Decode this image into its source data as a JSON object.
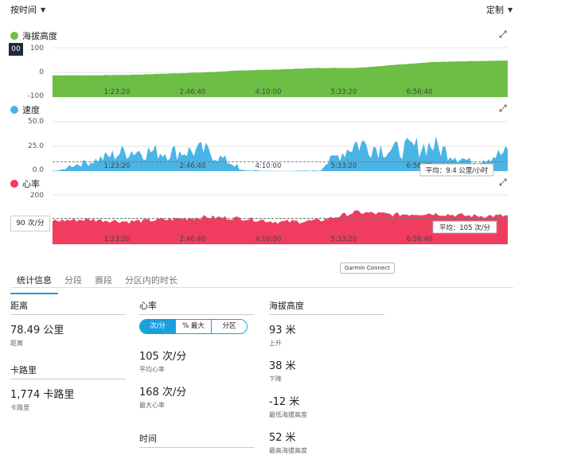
{
  "toolbar": {
    "sort_label": "按时间",
    "custom_label": "定制"
  },
  "colors": {
    "elevation": "#6cbe45",
    "speed": "#4ab4e6",
    "heart_rate": "#f03c5f",
    "accent": "#1aa0dd"
  },
  "charts": {
    "elevation": {
      "title": "海拔高度",
      "y_ticks": [
        "100",
        "0",
        "-100"
      ],
      "left_badge": "00"
    },
    "speed": {
      "title": "速度",
      "y_ticks": [
        "50.0",
        "25.0",
        "0.0"
      ],
      "avg_label": "平均：9.4 公里/小时"
    },
    "heart_rate": {
      "title": "心率",
      "y_ticks": [
        "200",
        "100"
      ],
      "left_badge": "90 次/分",
      "avg_label": "平均：105 次/分"
    },
    "x_ticks": [
      "1:23:20",
      "2:46:40",
      "4:10:00",
      "5:33:20",
      "6:56:40"
    ]
  },
  "chart_data": [
    {
      "type": "area",
      "title": "海拔高度",
      "ylim": [
        -100,
        100
      ],
      "x": [
        "0:00:00",
        "0:41:40",
        "1:23:20",
        "2:05:00",
        "2:46:40",
        "3:28:20",
        "4:10:00",
        "4:51:40",
        "5:33:20",
        "6:15:00",
        "6:56:40",
        "7:38:20",
        "8:20:00"
      ],
      "series": [
        {
          "name": "海拔高度",
          "values": [
            -12,
            -12,
            -10,
            -5,
            0,
            8,
            12,
            18,
            18,
            30,
            42,
            45,
            48
          ]
        }
      ]
    },
    {
      "type": "area",
      "title": "速度",
      "ylim": [
        0,
        50
      ],
      "avg": 9.4,
      "x": [
        "0:00:00",
        "0:41:40",
        "1:23:20",
        "2:05:00",
        "2:46:40",
        "3:28:20",
        "4:10:00",
        "4:51:40",
        "5:33:20",
        "6:15:00",
        "6:56:40",
        "7:38:20",
        "8:20:00"
      ],
      "series": [
        {
          "name": "速度",
          "values": [
            2,
            10,
            22,
            20,
            22,
            3,
            0,
            2,
            30,
            22,
            28,
            10,
            20
          ]
        }
      ]
    },
    {
      "type": "area",
      "title": "心率",
      "ylim": [
        0,
        200
      ],
      "avg": 105,
      "x": [
        "0:00:00",
        "0:41:40",
        "1:23:20",
        "2:05:00",
        "2:46:40",
        "3:28:20",
        "4:10:00",
        "4:51:40",
        "5:33:20",
        "6:15:00",
        "6:56:40",
        "7:38:20",
        "8:20:00"
      ],
      "series": [
        {
          "name": "心率",
          "values": [
            95,
            100,
            92,
            100,
            110,
            105,
            90,
            95,
            130,
            120,
            125,
            115,
            115
          ]
        }
      ]
    }
  ],
  "garmin_label": "Garmin Connect",
  "tabs": [
    "统计信息",
    "分段",
    "赛段",
    "分区内的时长"
  ],
  "stats": {
    "distance": {
      "heading": "距离",
      "value": "78.49 公里",
      "label": "距离"
    },
    "calories": {
      "heading": "卡路里",
      "value": "1,774 卡路里",
      "label": "卡路里"
    },
    "heart_rate": {
      "heading": "心率",
      "toggle": [
        "次/分",
        "% 最大",
        "分区"
      ],
      "avg_value": "105 次/分",
      "avg_label": "平均心率",
      "max_value": "168 次/分",
      "max_label": "最大心率"
    },
    "time": {
      "heading": "时间"
    },
    "elevation": {
      "heading": "海拔高度",
      "items": [
        {
          "value": "93 米",
          "label": "上升"
        },
        {
          "value": "38 米",
          "label": "下降"
        },
        {
          "value": "-12 米",
          "label": "最低海拔高度"
        },
        {
          "value": "52 米",
          "label": "最高海拔高度"
        }
      ]
    }
  }
}
